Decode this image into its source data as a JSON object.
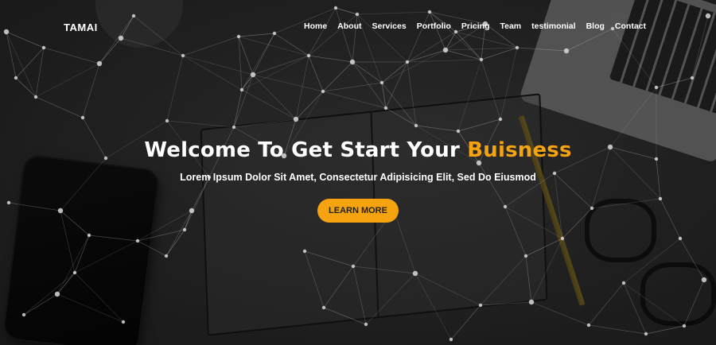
{
  "brand": "TAMAI",
  "nav": {
    "items": [
      "Home",
      "About",
      "Services",
      "Portfolio",
      "Pricing",
      "Team",
      "testimonial",
      "Blog",
      "Contact"
    ]
  },
  "hero": {
    "title_main": "Welcome To Get Start Your ",
    "title_accent": "Buisness",
    "subtitle": "Lorem Ipsum Dolor Sit Amet, Consectetur Adipisicing Elit, Sed Do Eiusmod",
    "cta_label": "LEARN MORE"
  },
  "colors": {
    "accent": "#f5a30e",
    "text": "#ffffff",
    "background": "#2b2b2b"
  }
}
